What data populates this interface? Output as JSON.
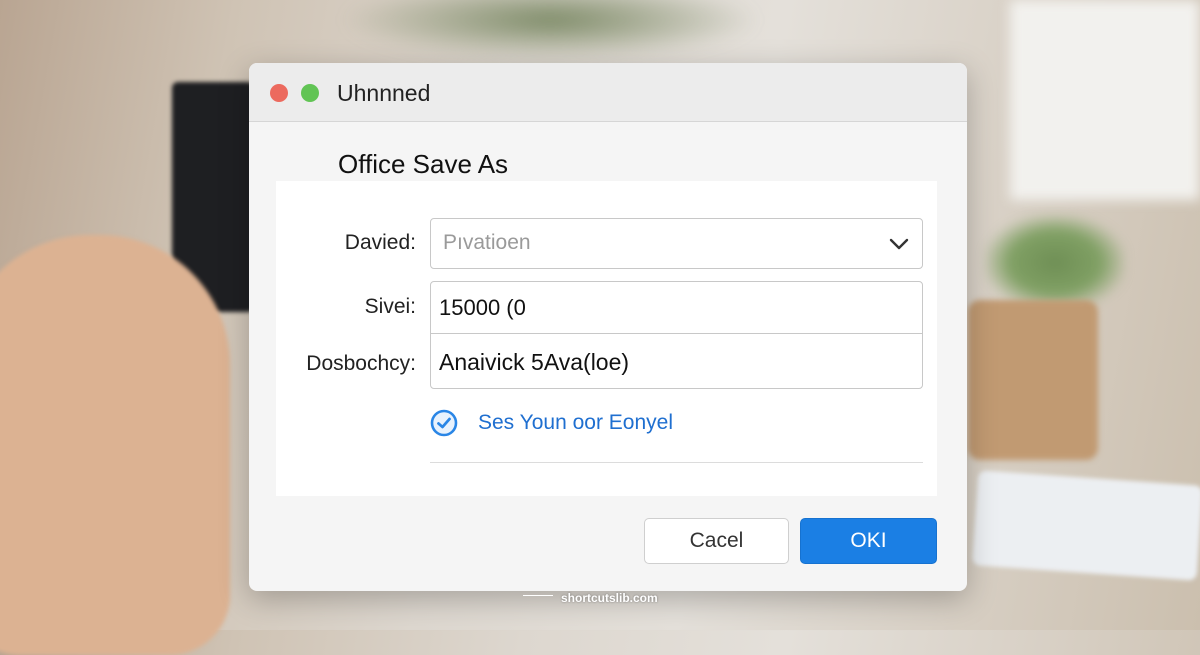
{
  "window": {
    "title": "Uhnnned",
    "traffic_lights": [
      "close",
      "zoom"
    ]
  },
  "dialog": {
    "heading": "Office Save As",
    "fields": [
      {
        "label": "Davied:",
        "value": "Pıvatioen",
        "type": "select"
      },
      {
        "label": "Sivei:",
        "value": "15000 (0",
        "type": "text"
      },
      {
        "label": "Dosbochcy:",
        "value": "Anaivick 5Ava(loe)",
        "type": "text"
      }
    ],
    "link": {
      "text": "Ses Youn oor Eonyel",
      "icon": "check-circle-icon"
    },
    "buttons": {
      "cancel": "Cacel",
      "ok": "OKI"
    }
  },
  "watermark": "shortcutslib.com",
  "colors": {
    "accent": "#1b7fe4",
    "link": "#1f6fd0",
    "close_light": "#ec6a5e",
    "zoom_light": "#61c454"
  }
}
